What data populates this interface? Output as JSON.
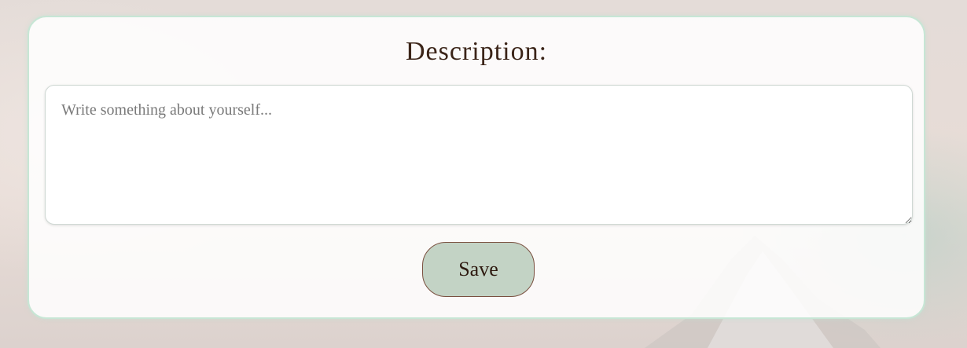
{
  "profile_editor": {
    "title": "Description:",
    "description": {
      "value": "",
      "placeholder": "Write something about yourself..."
    },
    "save_label": "Save"
  },
  "colors": {
    "card_border": "#c7e6d5",
    "button_background": "#c3d3c5",
    "button_border": "#7a5040",
    "text": "#3b2418"
  }
}
